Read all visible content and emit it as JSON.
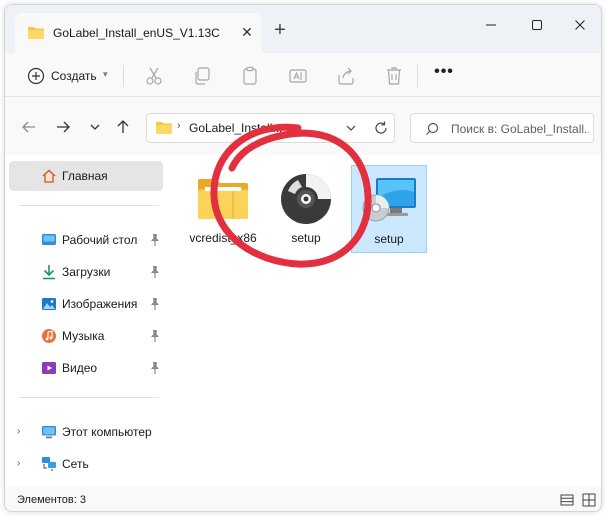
{
  "window": {
    "tab_title": "GoLabel_Install_enUS_V1.13C",
    "new_tab_label": "+"
  },
  "toolbar": {
    "create_label": "Создать",
    "more_label": "•••"
  },
  "address": {
    "path": "GoLabel_Install...",
    "separator": "›"
  },
  "search": {
    "placeholder": "Поиск в: GoLabel_Install..."
  },
  "sidebar": {
    "items": [
      {
        "label": "Главная",
        "icon": "home-icon"
      },
      {
        "label": "Рабочий стол",
        "icon": "desktop-icon"
      },
      {
        "label": "Загрузки",
        "icon": "downloads-icon"
      },
      {
        "label": "Изображения",
        "icon": "pictures-icon"
      },
      {
        "label": "Музыка",
        "icon": "music-icon"
      },
      {
        "label": "Видео",
        "icon": "videos-icon"
      },
      {
        "label": "Этот компьютер",
        "icon": "this-pc-icon"
      },
      {
        "label": "Сеть",
        "icon": "network-icon"
      }
    ]
  },
  "files": [
    {
      "name": "vcredist_x86",
      "icon": "folder-icon"
    },
    {
      "name": "setup",
      "icon": "disc-icon"
    },
    {
      "name": "setup",
      "icon": "setup-installer-icon"
    }
  ],
  "status": {
    "count_text": "Элементов: 3"
  },
  "colors": {
    "selection_bg": "#cce8ff",
    "selection_border": "#99d1ff",
    "folder_yellow": "#f8c73d",
    "annotation_red": "#e2303f"
  }
}
